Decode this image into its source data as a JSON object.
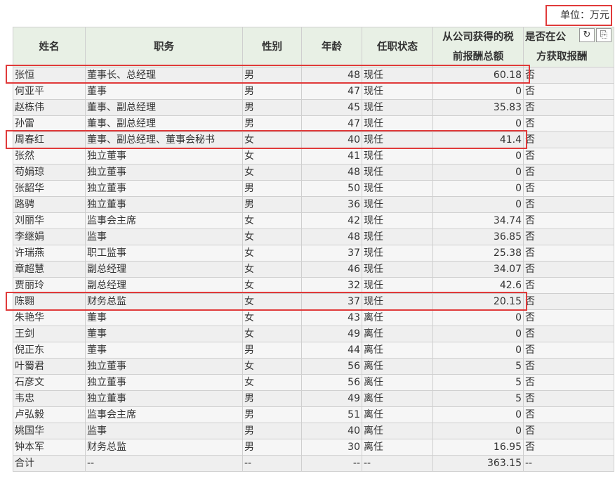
{
  "unit_label": "单位：万元",
  "toolbar": {
    "refresh_icon": "refresh-icon",
    "export_icon": "export-icon"
  },
  "colors": {
    "header_bg": "#e8f0e5",
    "highlight": "#e03a3a"
  },
  "headers": [
    "姓名",
    "职务",
    "性别",
    "年龄",
    "任职状态",
    "从公司获得的税前报酬总额",
    "是否在公司关联方获取报酬"
  ],
  "header_lines": {
    "h5a": "从公司获得的税",
    "h5b": "前报酬总额",
    "h6a": "是否在公",
    "h6b": "方获取报酬"
  },
  "rows": [
    [
      "张恒",
      "董事长、总经理",
      "男",
      "48",
      "现任",
      "60.18",
      "否"
    ],
    [
      "何亚平",
      "董事",
      "男",
      "47",
      "现任",
      "0",
      "否"
    ],
    [
      "赵栋伟",
      "董事、副总经理",
      "男",
      "45",
      "现任",
      "35.83",
      "否"
    ],
    [
      "孙雷",
      "董事、副总经理",
      "男",
      "47",
      "现任",
      "0",
      "否"
    ],
    [
      "周春红",
      "董事、副总经理、董事会秘书",
      "女",
      "40",
      "现任",
      "41.4",
      "否"
    ],
    [
      "张然",
      "独立董事",
      "女",
      "41",
      "现任",
      "0",
      "否"
    ],
    [
      "苟娟琼",
      "独立董事",
      "女",
      "48",
      "现任",
      "0",
      "否"
    ],
    [
      "张韶华",
      "独立董事",
      "男",
      "50",
      "现任",
      "0",
      "否"
    ],
    [
      "路骋",
      "独立董事",
      "男",
      "36",
      "现任",
      "0",
      "否"
    ],
    [
      "刘丽华",
      "监事会主席",
      "女",
      "42",
      "现任",
      "34.74",
      "否"
    ],
    [
      "李继娟",
      "监事",
      "女",
      "48",
      "现任",
      "36.85",
      "否"
    ],
    [
      "许瑞燕",
      "职工监事",
      "女",
      "37",
      "现任",
      "25.38",
      "否"
    ],
    [
      "章超慧",
      "副总经理",
      "女",
      "46",
      "现任",
      "34.07",
      "否"
    ],
    [
      "贾丽玲",
      "副总经理",
      "女",
      "32",
      "现任",
      "42.6",
      "否"
    ],
    [
      "陈翾",
      "财务总监",
      "女",
      "37",
      "现任",
      "20.15",
      "否"
    ],
    [
      "朱艳华",
      "董事",
      "女",
      "43",
      "离任",
      "0",
      "否"
    ],
    [
      "王剑",
      "董事",
      "女",
      "49",
      "离任",
      "0",
      "否"
    ],
    [
      "倪正东",
      "董事",
      "男",
      "44",
      "离任",
      "0",
      "否"
    ],
    [
      "叶蜀君",
      "独立董事",
      "女",
      "56",
      "离任",
      "5",
      "否"
    ],
    [
      "石彦文",
      "独立董事",
      "女",
      "56",
      "离任",
      "5",
      "否"
    ],
    [
      "韦忠",
      "独立董事",
      "男",
      "49",
      "离任",
      "5",
      "否"
    ],
    [
      "卢弘毅",
      "监事会主席",
      "男",
      "51",
      "离任",
      "0",
      "否"
    ],
    [
      "姚国华",
      "监事",
      "男",
      "40",
      "离任",
      "0",
      "否"
    ],
    [
      "钟本军",
      "财务总监",
      "男",
      "30",
      "离任",
      "16.95",
      "否"
    ],
    [
      "合计",
      "--",
      "--",
      "--",
      "--",
      "363.15",
      "--"
    ]
  ]
}
